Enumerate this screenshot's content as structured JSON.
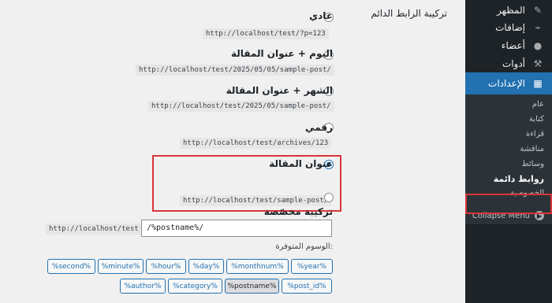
{
  "sidebar": {
    "items": [
      {
        "label": "المظهر",
        "icon": "paintbrush-icon"
      },
      {
        "label": "إضافات",
        "icon": "plugin-icon"
      },
      {
        "label": "أعضاء",
        "icon": "users-icon"
      },
      {
        "label": "أدوات",
        "icon": "wrench-icon"
      },
      {
        "label": "الإعدادات",
        "icon": "settings-icon"
      }
    ],
    "submenu": [
      "عام",
      "كتابة",
      "قراءة",
      "مناقشة",
      "وسائط",
      "روابط دائمة",
      "الخصوصية"
    ],
    "collapse_label": "Collapse Menu"
  },
  "permalinks": {
    "section_label": "تركيبة الرابط الدائم",
    "options": [
      {
        "label": "عادي",
        "example": "http://localhost/test/?p=123",
        "selected": false
      },
      {
        "label": "اليوم + عنوان المقالة",
        "example": "http://localhost/test/2025/05/05/sample-post/",
        "selected": false
      },
      {
        "label": "الشهر + عنوان المقالة",
        "example": "http://localhost/test/2025/05/sample-post/",
        "selected": false
      },
      {
        "label": "رقمي",
        "example": "http://localhost/test/archives/123",
        "selected": false
      },
      {
        "label": "عنوان المقالة",
        "example": "http://localhost/test/sample-post/",
        "selected": true
      }
    ],
    "custom": {
      "label": "تركيبة مخصّصة",
      "prefix": "http://localhost/test",
      "value": "/%postname%/"
    },
    "available_label": "الوسوم المتوفرة:",
    "tags_row1": [
      "%year%",
      "%monthnum%",
      "%day%",
      "%hour%",
      "%minute%",
      "%second%"
    ],
    "tags_row2": [
      "%post_id%",
      "%postname%",
      "%category%",
      "%author%"
    ],
    "pressed_tag": "%postname%"
  }
}
